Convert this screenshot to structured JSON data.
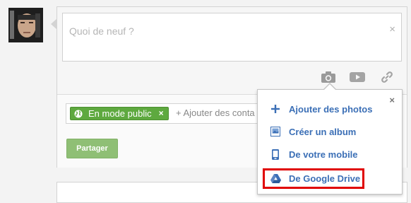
{
  "composer": {
    "placeholder": "Quoi de neuf ?",
    "close_icon": "×",
    "media_icons": [
      "camera-icon",
      "video-icon",
      "link-icon"
    ]
  },
  "share": {
    "chip_label": "En mode public",
    "chip_remove": "×",
    "add_contacts": "+ Ajouter des conta",
    "share_button": "Partager"
  },
  "dropdown": {
    "close": "×",
    "items": [
      {
        "label": "Ajouter des photos",
        "icon": "plus-icon"
      },
      {
        "label": "Créer un album",
        "icon": "album-icon"
      },
      {
        "label": "De votre mobile",
        "icon": "mobile-icon"
      },
      {
        "label": "De Google Drive",
        "icon": "google-drive-icon",
        "highlighted": true
      }
    ]
  },
  "colors": {
    "link_blue": "#3b6fb6",
    "chip_green": "#5ea93f",
    "share_button_green": "#8fbf75",
    "highlight_red": "#e00000"
  }
}
